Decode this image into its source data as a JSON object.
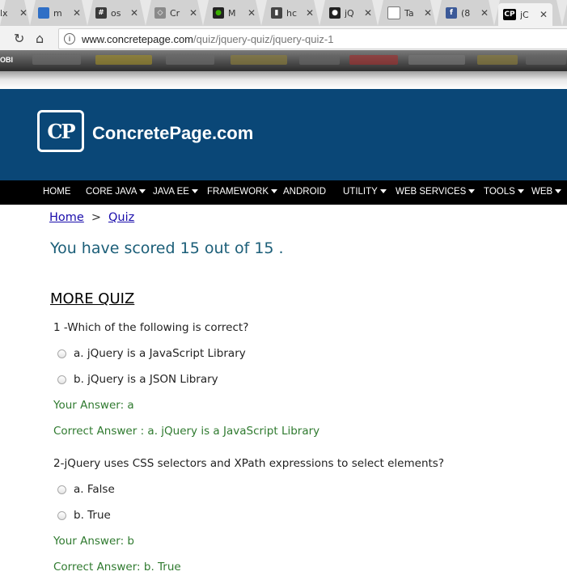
{
  "browser": {
    "tabs": [
      {
        "title": "lx",
        "favicon_color": "#4a4a4a",
        "favicon_glyph": ""
      },
      {
        "title": "m",
        "favicon_color": "#2f6fc6",
        "favicon_glyph": ""
      },
      {
        "title": "os",
        "favicon_color": "#3a3a3a",
        "favicon_glyph": "#"
      },
      {
        "title": "Cr",
        "favicon_color": "#6a6a6a",
        "favicon_glyph": "◇"
      },
      {
        "title": "M",
        "favicon_color": "#3bb000",
        "favicon_glyph": "●"
      },
      {
        "title": "hc",
        "favicon_color": "#444444",
        "favicon_glyph": "▮"
      },
      {
        "title": "jQ",
        "favicon_color": "#222222",
        "favicon_glyph": "●"
      },
      {
        "title": "Ta",
        "favicon_color": "#ffffff",
        "favicon_glyph": "□"
      },
      {
        "title": "(8",
        "favicon_color": "#3b5998",
        "favicon_glyph": "f"
      },
      {
        "title": "jC",
        "favicon_color": "#000000",
        "favicon_glyph": "CP"
      }
    ],
    "close_glyph": "✕",
    "address": {
      "host": "www.concretepage.com",
      "path": "/quiz/jquery-quiz/jquery-quiz-1"
    },
    "bookmarks_label": "OBI"
  },
  "site": {
    "logo_letters": "CP",
    "name": "ConcretePage.com",
    "header_color": "#0a4777",
    "nav": [
      {
        "label": "HOME",
        "dropdown": false
      },
      {
        "label": "CORE JAVA",
        "dropdown": true
      },
      {
        "label": "JAVA EE",
        "dropdown": true
      },
      {
        "label": "FRAMEWORK",
        "dropdown": true
      },
      {
        "label": "ANDROID",
        "dropdown": false
      },
      {
        "label": "UTILITY",
        "dropdown": true
      },
      {
        "label": "WEB SERVICES",
        "dropdown": true
      },
      {
        "label": "TOOLS",
        "dropdown": true
      },
      {
        "label": "WEB",
        "dropdown": true
      }
    ]
  },
  "breadcrumb": {
    "home": "Home",
    "separator": ">",
    "current": "Quiz"
  },
  "score_text": "You have scored 15 out of 15 .",
  "more_quiz": "MORE QUIZ",
  "questions": [
    {
      "question": "1 -Which of the following is correct?",
      "options": [
        "a. jQuery is a JavaScript Library",
        "b. jQuery is a JSON Library"
      ],
      "your_answer": "Your Answer: a",
      "correct_answer": "Correct Answer : a. jQuery is a JavaScript Library"
    },
    {
      "question": "2-jQuery uses CSS selectors and XPath expressions to select elements?",
      "options": [
        "a. False",
        "b. True"
      ],
      "your_answer": "Your Answer: b",
      "correct_answer": "Correct Answer: b. True"
    }
  ]
}
